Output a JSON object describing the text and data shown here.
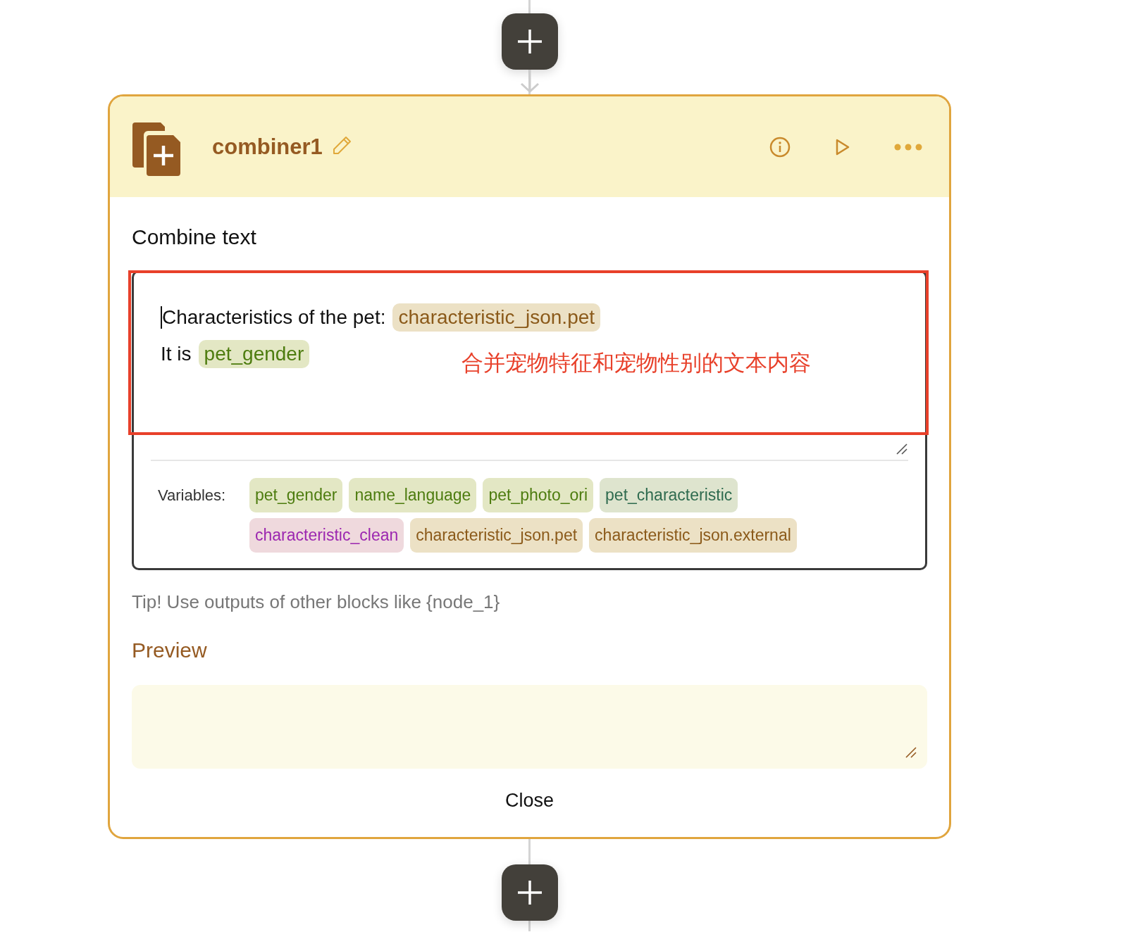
{
  "node": {
    "title": "combiner1"
  },
  "section_title": "Combine text",
  "editor": {
    "lines": [
      {
        "parts": [
          {
            "kind": "text",
            "text": "Characteristics of the pet:"
          },
          {
            "kind": "variable",
            "text": "characteristic_json.pet",
            "color": "#8b5a1a"
          }
        ]
      },
      {
        "parts": [
          {
            "kind": "text",
            "text": "It is"
          },
          {
            "kind": "variable",
            "text": "pet_gender",
            "color": "#4d7c0f"
          }
        ]
      }
    ],
    "annotation": "合并宠物特征和宠物性别的文本内容",
    "variables_label": "Variables:",
    "variables": [
      {
        "label": "pet_gender",
        "color": "#4d7c0f"
      },
      {
        "label": "name_language",
        "color": "#4d7c0f"
      },
      {
        "label": "pet_photo_ori",
        "color": "#4d7c0f"
      },
      {
        "label": "pet_characteristic",
        "color": "#2f6b4f"
      },
      {
        "label": "characteristic_clean",
        "color": "#9c27b0"
      },
      {
        "label": "characteristic_json.pet",
        "color": "#8b5a1a"
      },
      {
        "label": "characteristic_json.external",
        "color": "#8b5a1a"
      }
    ]
  },
  "tip": "Tip! Use outputs of other blocks like {node_1}",
  "preview": {
    "title": "Preview"
  },
  "close_button": "Close"
}
